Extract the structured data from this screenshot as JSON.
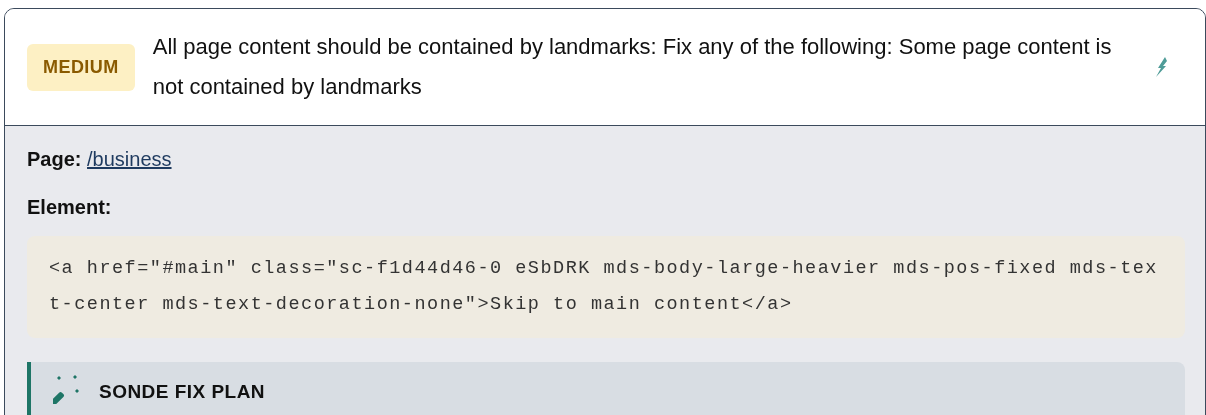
{
  "issue": {
    "severity": "MEDIUM",
    "title": "All page content should be contained by landmarks: Fix any of the following: Some page content is not contained by landmarks"
  },
  "details": {
    "page_label": "Page:",
    "page_link": "/business",
    "element_label": "Element:",
    "element_code": "<a href=\"#main\" class=\"sc-f1d44d46-0 eSbDRK mds-body-large-heavier mds-pos-fixed mds-text-center mds-text-decoration-none\">Skip to main content</a>"
  },
  "fix_plan": {
    "title": "SONDE FIX PLAN"
  }
}
